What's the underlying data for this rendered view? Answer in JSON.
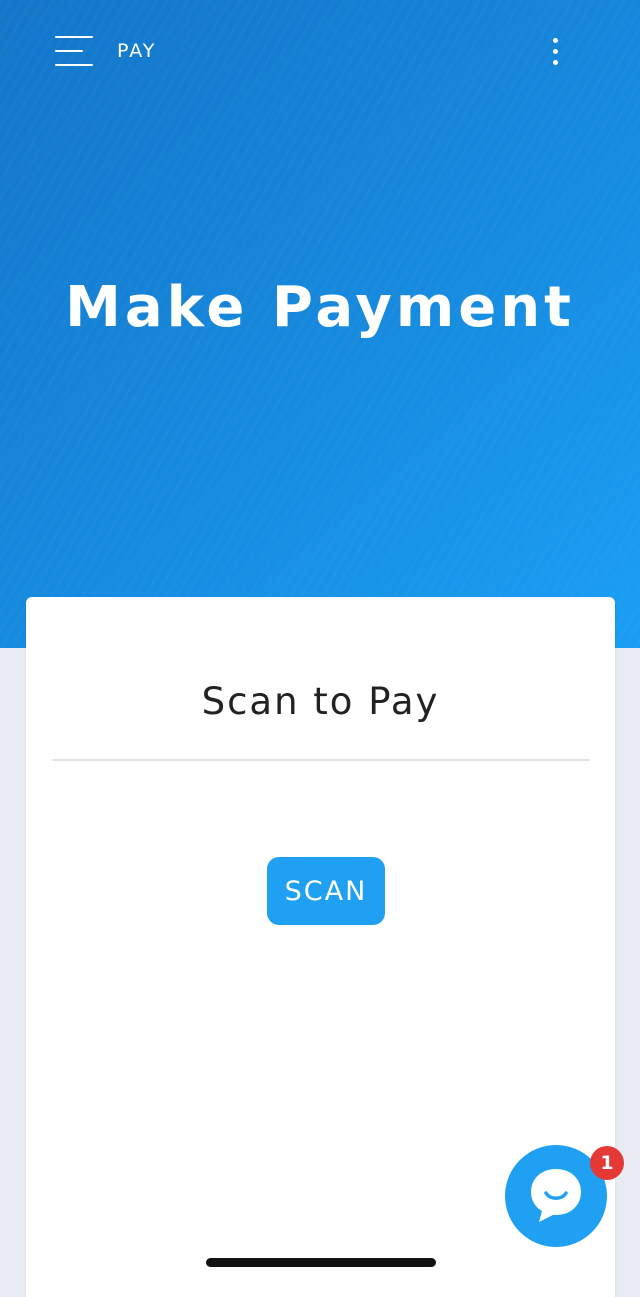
{
  "header": {
    "app_title": "PAY",
    "menu_icon": "hamburger-menu-icon",
    "more_icon": "vertical-dots-icon"
  },
  "hero": {
    "title": "Make Payment"
  },
  "card": {
    "title": "Scan to Pay",
    "scan_button_label": "SCAN"
  },
  "chat": {
    "icon": "chat-bubble-icon",
    "badge_count": "1"
  },
  "colors": {
    "hero_gradient_start": "#1476c9",
    "hero_gradient_end": "#1a9ff5",
    "accent": "#1fa0f2",
    "badge": "#e53935",
    "page_background": "#e9ebf2"
  }
}
